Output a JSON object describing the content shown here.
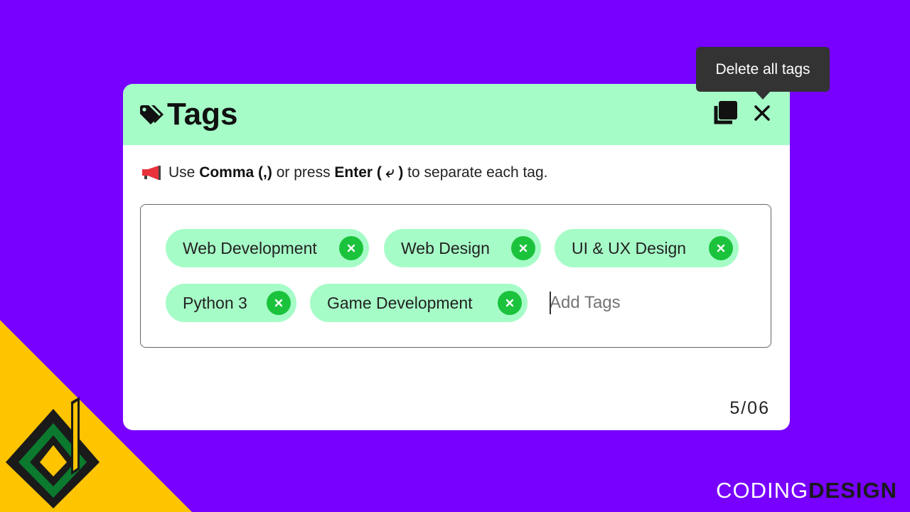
{
  "colors": {
    "background": "#7700ff",
    "accent_corner": "#ffc400",
    "header": "#a6fcc7",
    "chip": "#a6fcc7",
    "chip_remove": "#1bc33c",
    "tooltip": "#333333"
  },
  "card": {
    "title": "Tags",
    "title_icon": "tags-icon",
    "copy_icon": "copy-icon",
    "close_icon": "close-icon"
  },
  "instructions": {
    "icon": "megaphone-icon",
    "part1": "Use ",
    "comma": "Comma (,)",
    "part2": " or press ",
    "enter": "Enter ( ⤶ )",
    "part3": " to separate each tag."
  },
  "tags": [
    {
      "label": "Web Development"
    },
    {
      "label": "Web Design"
    },
    {
      "label": "UI & UX Design"
    },
    {
      "label": "Python 3"
    },
    {
      "label": "Game Development"
    }
  ],
  "input": {
    "placeholder": "Add Tags"
  },
  "counter": "5/06",
  "tooltip": "Delete all tags",
  "brand": {
    "part1": "CODING",
    "part2": "DESIGN"
  }
}
